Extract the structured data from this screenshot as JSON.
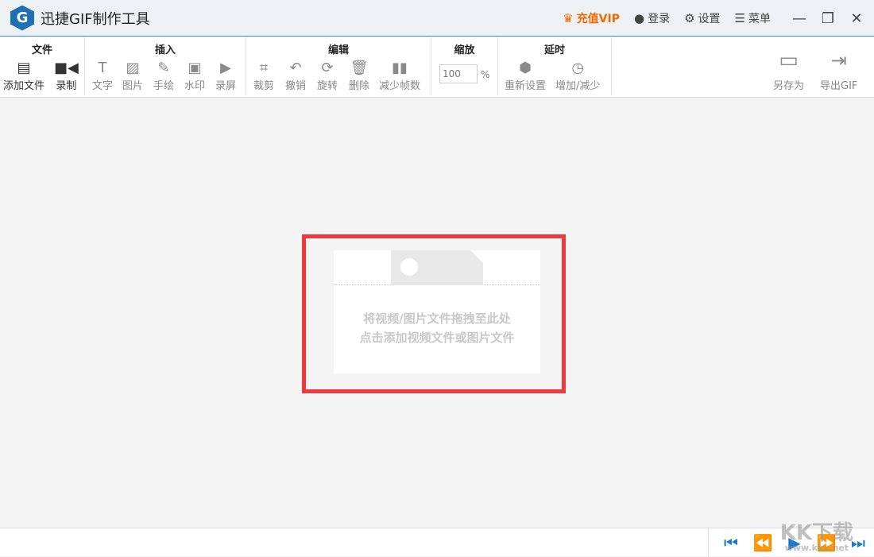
{
  "app": {
    "title": "迅捷GIF制作工具",
    "logo_letter": "G"
  },
  "titlebar": {
    "vip": "充值VIP",
    "login": "登录",
    "settings": "设置",
    "menu": "菜单",
    "minimize": "—",
    "maximize": "❐",
    "close": "✕"
  },
  "toolbar": {
    "file": {
      "title": "文件",
      "add": "添加文件",
      "record": "录制"
    },
    "insert": {
      "title": "插入",
      "text": "文字",
      "image": "图片",
      "draw": "手绘",
      "watermark": "水印",
      "screen": "录屏"
    },
    "edit": {
      "title": "编辑",
      "crop": "裁剪",
      "undo": "撤销",
      "rotate": "旋转",
      "delete": "删除",
      "reduce": "减少帧数"
    },
    "zoom": {
      "title": "缩放",
      "value": "100",
      "unit": "%"
    },
    "delay": {
      "title": "延时",
      "reset": "重新设置",
      "adjust": "增加/减少"
    },
    "save_as": "另存为",
    "export": "导出GIF"
  },
  "drop": {
    "line1": "将视频/图片文件拖拽至此处",
    "line2": "点击添加视频文件或图片文件"
  },
  "watermark": {
    "logo": "KK下载",
    "url": "www.kkx.net"
  }
}
